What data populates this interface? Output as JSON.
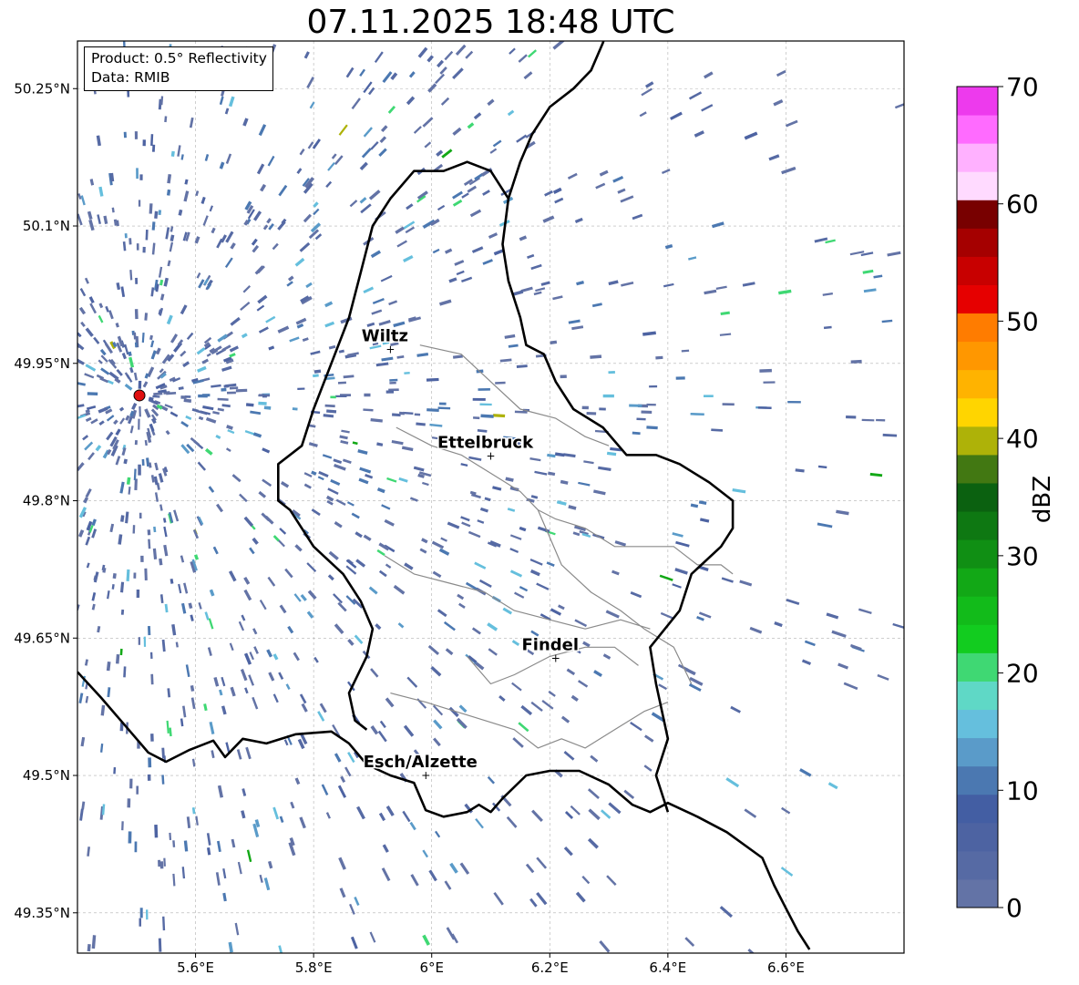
{
  "title": "07.11.2025 18:48 UTC",
  "info_box": {
    "product": "Product: 0.5° Reflectivity",
    "data": "Data: RMIB"
  },
  "lon_ticks": [
    {
      "value": 5.6,
      "label": "5.6°E"
    },
    {
      "value": 5.8,
      "label": "5.8°E"
    },
    {
      "value": 6.0,
      "label": "6°E"
    },
    {
      "value": 6.2,
      "label": "6.2°E"
    },
    {
      "value": 6.4,
      "label": "6.4°E"
    },
    {
      "value": 6.6,
      "label": "6.6°E"
    }
  ],
  "lat_ticks": [
    {
      "value": 50.25,
      "label": "50.25°N"
    },
    {
      "value": 50.1,
      "label": "50.1°N"
    },
    {
      "value": 49.95,
      "label": "49.95°N"
    },
    {
      "value": 49.8,
      "label": "49.8°N"
    },
    {
      "value": 49.65,
      "label": "49.65°N"
    },
    {
      "value": 49.5,
      "label": "49.5°N"
    },
    {
      "value": 49.35,
      "label": "49.35°N"
    }
  ],
  "cities": [
    {
      "name": "Wiltz",
      "lon": 5.93,
      "lat": 49.965
    },
    {
      "name": "Ettelbruck",
      "lon": 6.1,
      "lat": 49.849
    },
    {
      "name": "Findel",
      "lon": 6.21,
      "lat": 49.628
    },
    {
      "name": "Esch/Alzette",
      "lon": 5.99,
      "lat": 49.5
    }
  ],
  "radar_site": {
    "lon": 5.505,
    "lat": 49.915,
    "color": "#e01010"
  },
  "colorbar": {
    "label": "dBZ",
    "min": 0,
    "max": 70,
    "step": 2.5,
    "ticks": [
      {
        "value": 0,
        "label": "0"
      },
      {
        "value": 10,
        "label": "10"
      },
      {
        "value": 20,
        "label": "20"
      },
      {
        "value": 30,
        "label": "30"
      },
      {
        "value": 40,
        "label": "40"
      },
      {
        "value": 50,
        "label": "50"
      },
      {
        "value": 60,
        "label": "60"
      },
      {
        "value": 70,
        "label": "70"
      }
    ],
    "colors": [
      "#6373a6",
      "#566aa4",
      "#4d63a2",
      "#435ea3",
      "#4b78b1",
      "#5a9bc9",
      "#65bfdd",
      "#5fd8c6",
      "#3fd873",
      "#12cc1f",
      "#12bb1a",
      "#12a816",
      "#108f14",
      "#0e7812",
      "#0b6110",
      "#427812",
      "#aeb208",
      "#ffd500",
      "#ffb300",
      "#ff9700",
      "#ff7c00",
      "#e60000",
      "#c80000",
      "#a50000",
      "#780000",
      "#ffdaff",
      "#ffb1ff",
      "#ff6bff",
      "#ed3aed"
    ]
  },
  "borders": {
    "national": [
      [
        [
          5.4,
          49.613
        ],
        [
          5.44,
          49.585
        ],
        [
          5.48,
          49.555
        ],
        [
          5.5,
          49.54
        ],
        [
          5.52,
          49.525
        ],
        [
          5.55,
          49.515
        ],
        [
          5.59,
          49.528
        ],
        [
          5.63,
          49.538
        ],
        [
          5.65,
          49.52
        ],
        [
          5.68,
          49.54
        ],
        [
          5.72,
          49.535
        ],
        [
          5.77,
          49.545
        ],
        [
          5.83,
          49.548
        ],
        [
          5.86,
          49.535
        ],
        [
          5.89,
          49.512
        ],
        [
          5.93,
          49.5
        ],
        [
          5.97,
          49.492
        ],
        [
          5.99,
          49.462
        ],
        [
          6.02,
          49.455
        ],
        [
          6.06,
          49.46
        ],
        [
          6.08,
          49.468
        ],
        [
          6.1,
          49.46
        ],
        [
          6.12,
          49.475
        ],
        [
          6.16,
          49.5
        ],
        [
          6.2,
          49.505
        ],
        [
          6.25,
          49.505
        ],
        [
          6.3,
          49.49
        ],
        [
          6.34,
          49.468
        ],
        [
          6.37,
          49.46
        ],
        [
          6.4,
          49.47
        ],
        [
          6.45,
          49.455
        ],
        [
          6.5,
          49.438
        ],
        [
          6.56,
          49.41
        ],
        [
          6.58,
          49.38
        ],
        [
          6.6,
          49.355
        ],
        [
          6.62,
          49.33
        ],
        [
          6.64,
          49.31
        ]
      ],
      [
        [
          6.4,
          49.46
        ],
        [
          6.38,
          49.5
        ],
        [
          6.4,
          49.54
        ],
        [
          6.38,
          49.6
        ],
        [
          6.37,
          49.64
        ],
        [
          6.42,
          49.68
        ],
        [
          6.44,
          49.72
        ],
        [
          6.49,
          49.75
        ],
        [
          6.51,
          49.77
        ],
        [
          6.51,
          49.8
        ],
        [
          6.47,
          49.82
        ],
        [
          6.42,
          49.84
        ],
        [
          6.38,
          49.85
        ],
        [
          6.33,
          49.85
        ],
        [
          6.29,
          49.88
        ],
        [
          6.24,
          49.9
        ],
        [
          6.21,
          49.93
        ],
        [
          6.19,
          49.96
        ],
        [
          6.16,
          49.97
        ],
        [
          6.15,
          50.0
        ],
        [
          6.13,
          50.04
        ],
        [
          6.12,
          50.08
        ],
        [
          6.13,
          50.13
        ],
        [
          6.15,
          50.17
        ],
        [
          6.17,
          50.2
        ],
        [
          6.2,
          50.23
        ],
        [
          6.24,
          50.25
        ],
        [
          6.27,
          50.27
        ],
        [
          6.29,
          50.3
        ],
        [
          6.3,
          50.32
        ]
      ],
      [
        [
          6.13,
          50.13
        ],
        [
          6.1,
          50.16
        ],
        [
          6.06,
          50.17
        ],
        [
          6.02,
          50.16
        ],
        [
          5.97,
          50.16
        ],
        [
          5.93,
          50.13
        ],
        [
          5.9,
          50.1
        ],
        [
          5.88,
          50.05
        ],
        [
          5.86,
          50.0
        ],
        [
          5.83,
          49.95
        ],
        [
          5.8,
          49.9
        ],
        [
          5.78,
          49.86
        ],
        [
          5.74,
          49.84
        ],
        [
          5.74,
          49.8
        ],
        [
          5.76,
          49.79
        ],
        [
          5.8,
          49.75
        ],
        [
          5.85,
          49.72
        ],
        [
          5.88,
          49.69
        ],
        [
          5.9,
          49.66
        ],
        [
          5.89,
          49.63
        ],
        [
          5.86,
          49.59
        ],
        [
          5.87,
          49.56
        ],
        [
          5.89,
          49.55
        ]
      ]
    ],
    "regional": [
      [
        [
          5.98,
          49.97
        ],
        [
          6.05,
          49.96
        ],
        [
          6.1,
          49.93
        ],
        [
          6.15,
          49.9
        ],
        [
          6.21,
          49.89
        ],
        [
          6.26,
          49.87
        ],
        [
          6.3,
          49.86
        ]
      ],
      [
        [
          5.94,
          49.88
        ],
        [
          6.0,
          49.86
        ],
        [
          6.05,
          49.85
        ],
        [
          6.1,
          49.83
        ],
        [
          6.15,
          49.81
        ],
        [
          6.18,
          49.79
        ],
        [
          6.21,
          49.78
        ],
        [
          6.26,
          49.77
        ],
        [
          6.31,
          49.75
        ],
        [
          6.36,
          49.75
        ],
        [
          6.41,
          49.75
        ],
        [
          6.45,
          49.73
        ],
        [
          6.49,
          49.73
        ],
        [
          6.51,
          49.72
        ]
      ],
      [
        [
          6.18,
          49.79
        ],
        [
          6.2,
          49.76
        ],
        [
          6.22,
          49.73
        ],
        [
          6.27,
          49.7
        ],
        [
          6.32,
          49.68
        ],
        [
          6.36,
          49.66
        ],
        [
          6.41,
          49.64
        ],
        [
          6.44,
          49.6
        ]
      ],
      [
        [
          5.93,
          49.59
        ],
        [
          5.99,
          49.58
        ],
        [
          6.04,
          49.57
        ],
        [
          6.09,
          49.56
        ],
        [
          6.14,
          49.55
        ],
        [
          6.18,
          49.53
        ],
        [
          6.22,
          49.54
        ],
        [
          6.26,
          49.53
        ],
        [
          6.31,
          49.55
        ],
        [
          6.36,
          49.57
        ],
        [
          6.4,
          49.58
        ]
      ],
      [
        [
          6.06,
          49.63
        ],
        [
          6.1,
          49.6
        ],
        [
          6.14,
          49.61
        ],
        [
          6.2,
          49.63
        ],
        [
          6.26,
          49.64
        ],
        [
          6.31,
          49.64
        ],
        [
          6.35,
          49.62
        ]
      ],
      [
        [
          5.92,
          49.74
        ],
        [
          5.97,
          49.72
        ],
        [
          6.03,
          49.71
        ],
        [
          6.09,
          49.7
        ],
        [
          6.14,
          49.68
        ],
        [
          6.2,
          49.67
        ],
        [
          6.26,
          49.66
        ],
        [
          6.32,
          49.67
        ],
        [
          6.37,
          49.66
        ]
      ]
    ]
  }
}
